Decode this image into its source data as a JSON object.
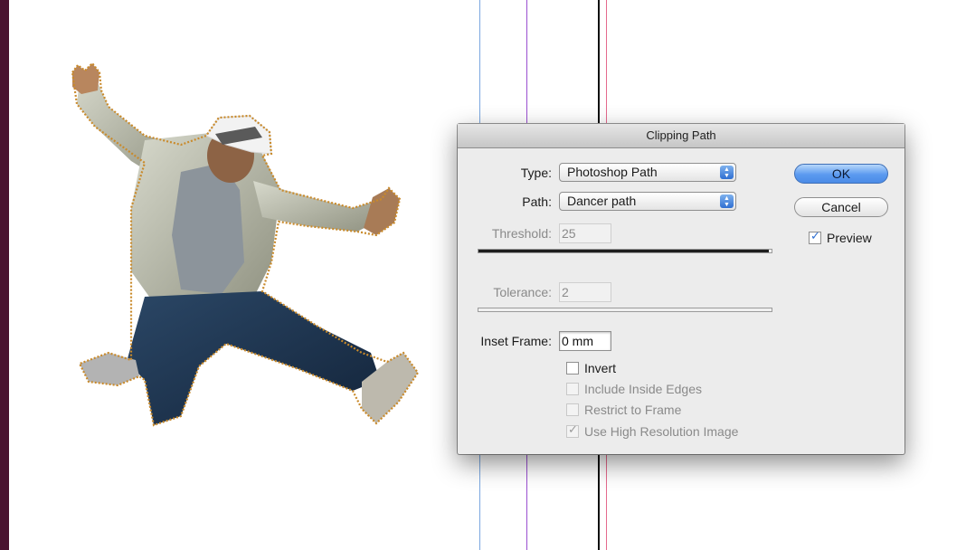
{
  "dialog": {
    "title": "Clipping Path",
    "type_label": "Type:",
    "type_value": "Photoshop Path",
    "path_label": "Path:",
    "path_value": "Dancer path",
    "threshold_label": "Threshold:",
    "threshold_value": "25",
    "threshold_fill": 0.99,
    "tolerance_label": "Tolerance:",
    "tolerance_value": "2",
    "tolerance_fill": 0.0,
    "inset_label": "Inset Frame:",
    "inset_value": "0 mm",
    "options": [
      {
        "label": "Invert",
        "checked": false,
        "enabled": true
      },
      {
        "label": "Include Inside Edges",
        "checked": false,
        "enabled": false
      },
      {
        "label": "Restrict to Frame",
        "checked": false,
        "enabled": false
      },
      {
        "label": "Use High Resolution Image",
        "checked": true,
        "enabled": false
      }
    ],
    "ok_label": "OK",
    "cancel_label": "Cancel",
    "preview_label": "Preview",
    "preview_checked": true
  },
  "colors": {
    "left_bar": "#4a1330",
    "path_outline": "#c98a2b",
    "ok_button": "#5b9af0",
    "check_blue": "#2f6fd1"
  }
}
